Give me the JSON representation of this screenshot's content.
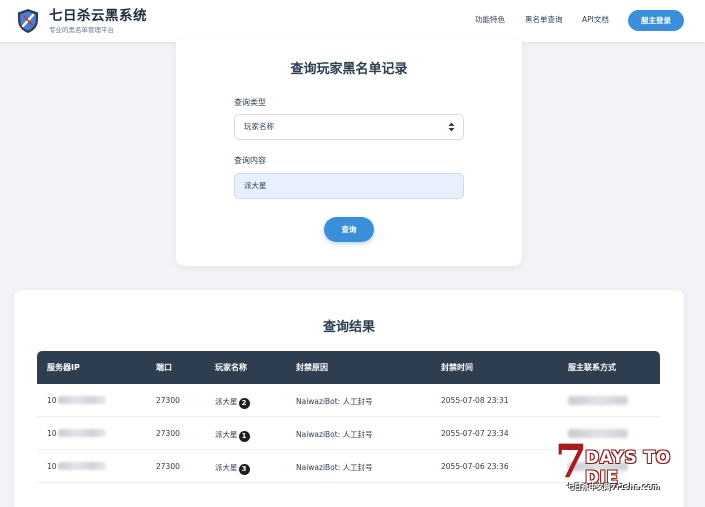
{
  "header": {
    "title": "七日杀云黑系统",
    "subtitle": "专业的黑名单管理平台",
    "nav": [
      "功能特色",
      "黑名单查询",
      "API文档"
    ],
    "login_label": "服主登录"
  },
  "query_form": {
    "title": "查询玩家黑名单记录",
    "type_label": "查询类型",
    "type_value": "玩家名称",
    "content_label": "查询内容",
    "content_value": "派大星",
    "submit_label": "查询"
  },
  "results": {
    "title": "查询结果",
    "columns": [
      "服务器IP",
      "端口",
      "玩家名称",
      "封禁原因",
      "封禁时间",
      "服主联系方式"
    ],
    "rows": [
      {
        "ip": "10",
        "port": "27300",
        "player": "派大星",
        "badge": "2",
        "reason": "NaiwaziBot: 人工封号",
        "time": "2055-07-08 23:31"
      },
      {
        "ip": "10",
        "port": "27300",
        "player": "派大星",
        "badge": "1",
        "reason": "NaiwaziBot: 人工封号",
        "time": "2055-07-07 23:34"
      },
      {
        "ip": "10",
        "port": "27300",
        "player": "派大星",
        "badge": "3",
        "reason": "NaiwaziBot: 人工封号",
        "time": "2055-07-06 23:36"
      }
    ]
  },
  "watermark": {
    "mark": "7",
    "title": "DAYS TO DIE",
    "site": "七日杀中文网7r1sha.com"
  },
  "colors": {
    "accent": "#3b8fd9",
    "table_header": "#2c3e50",
    "input_fill": "#e8f0fe",
    "watermark_red": "#a61c1c"
  }
}
